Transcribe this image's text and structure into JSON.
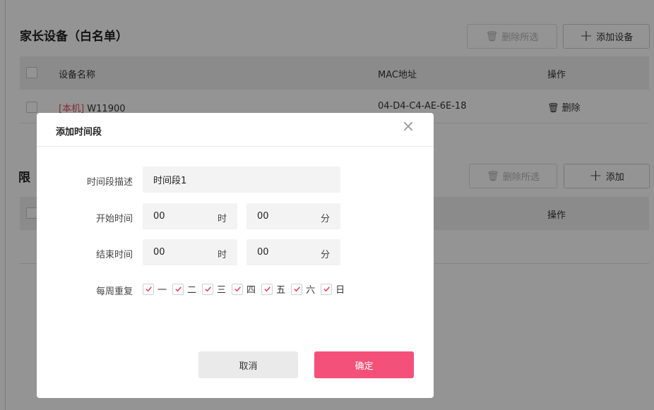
{
  "whitelist": {
    "title": "家长设备（白名单）",
    "delete_selected": "删除所选",
    "add_button": "添加设备",
    "columns": [
      "设备名称",
      "MAC地址",
      "操作"
    ],
    "rows": [
      {
        "tag": "[本机]",
        "name": "W11900",
        "mac": "04-D4-C4-AE-6E-18",
        "action": "删除"
      }
    ]
  },
  "restrict": {
    "title_partial": "限",
    "delete_selected": "删除所选",
    "add_button": "添加",
    "action_header": "操作"
  },
  "modal": {
    "title": "添加时间段",
    "close_glyph": "×",
    "desc_label": "时间段描述",
    "desc_value": "时间段1",
    "start_label": "开始时间",
    "end_label": "结束时间",
    "start_hour": "00",
    "start_minute": "00",
    "end_hour": "00",
    "end_minute": "00",
    "hour_unit": "时",
    "minute_unit": "分",
    "repeat_label": "每周重复",
    "days": [
      "一",
      "二",
      "三",
      "四",
      "五",
      "六",
      "日"
    ],
    "days_checked": [
      true,
      true,
      true,
      true,
      true,
      true,
      true
    ],
    "cancel": "取消",
    "confirm": "确定"
  },
  "icons": {
    "trash": "trash-icon",
    "plus": "plus-icon",
    "close": "close-icon",
    "check": "check-icon"
  },
  "colors": {
    "accent": "#f4517a",
    "tag_red": "#e8475c",
    "check_mark": "#e8475c"
  }
}
